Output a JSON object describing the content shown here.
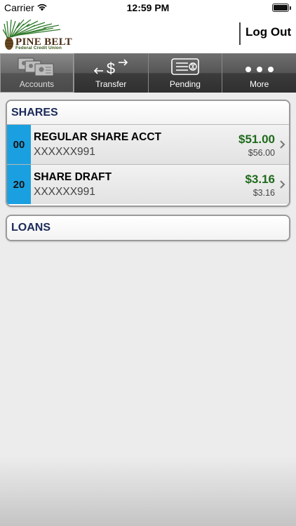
{
  "status_bar": {
    "carrier": "Carrier",
    "time": "12:59 PM"
  },
  "header": {
    "logo_title": "PINE BELT",
    "logo_subtitle": "Federal Credit Union",
    "logout_label": "Log Out"
  },
  "nav": {
    "items": [
      {
        "label": "Accounts",
        "icon": "accounts-cards-icon",
        "active": true
      },
      {
        "label": "Transfer",
        "icon": "transfer-dollar-icon",
        "active": false
      },
      {
        "label": "Pending",
        "icon": "pending-check-icon",
        "active": false
      },
      {
        "label": "More",
        "icon": "more-dots-icon",
        "active": false
      }
    ]
  },
  "shares": {
    "title": "SHARES",
    "accounts": [
      {
        "suffix": "00",
        "name": "REGULAR SHARE ACCT",
        "number": "XXXXXX991",
        "available": "$51.00",
        "current": "$56.00"
      },
      {
        "suffix": "20",
        "name": "SHARE DRAFT",
        "number": "XXXXXX991",
        "available": "$3.16",
        "current": "$3.16"
      }
    ]
  },
  "loans": {
    "title": "LOANS"
  },
  "colors": {
    "accent_blue": "#1aa0e0",
    "balance_green": "#1f6b1c",
    "section_title": "#1c2a5a"
  }
}
